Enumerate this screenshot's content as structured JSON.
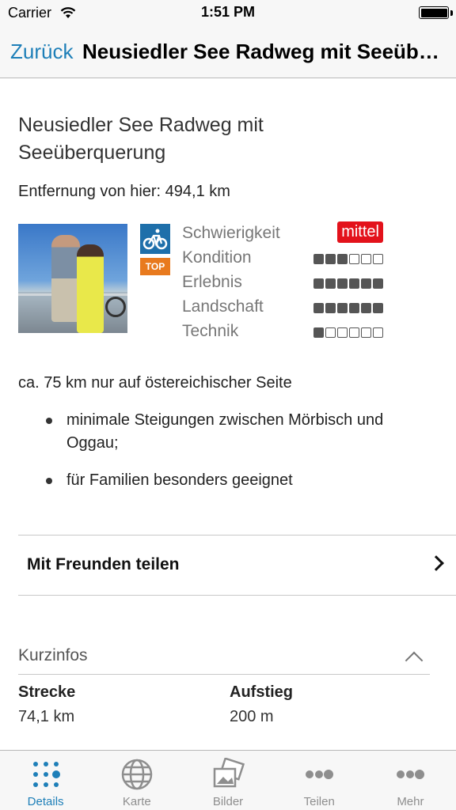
{
  "status_bar": {
    "carrier": "Carrier",
    "time": "1:51 PM"
  },
  "nav": {
    "back_label": "Zurück",
    "title": "Neusiedler See Radweg mit Seeüberquerung"
  },
  "route": {
    "title": "Neusiedler See Radweg mit Seeüberquerung",
    "distance": "Entfernung von hier: 494,1 km",
    "badge": "TOP",
    "ratings": [
      {
        "label": "Schwierigkeit",
        "value": "mittel"
      },
      {
        "label": "Kondition",
        "filled": 3,
        "total": 6
      },
      {
        "label": "Erlebnis",
        "filled": 6,
        "total": 6
      },
      {
        "label": "Landschaft",
        "filled": 6,
        "total": 6
      },
      {
        "label": "Technik",
        "filled": 1,
        "total": 6
      }
    ],
    "description": "ca. 75 km nur auf östereichischer Seite",
    "bullets": [
      "minimale Steigungen zwischen Mörbisch und Oggau;",
      "für Familien besonders geeignet"
    ]
  },
  "share": {
    "label": "Mit Freunden teilen"
  },
  "kurzinfos": {
    "header": "Kurzinfos",
    "items": [
      {
        "key": "Strecke",
        "value": "74,1 km"
      },
      {
        "key": "Aufstieg",
        "value": "200 m"
      }
    ]
  },
  "tabs": [
    {
      "label": "Details",
      "icon": "dots-grid-icon",
      "active": true
    },
    {
      "label": "Karte",
      "icon": "globe-icon",
      "active": false
    },
    {
      "label": "Bilder",
      "icon": "pictures-icon",
      "active": false
    },
    {
      "label": "Teilen",
      "icon": "share-dots-icon",
      "active": false
    },
    {
      "label": "Mehr",
      "icon": "more-dots-icon",
      "active": false
    }
  ],
  "colors": {
    "accent": "#1e7fb8",
    "difficulty": "#e3121b",
    "top_badge": "#e87a1e",
    "bike_badge": "#1e6faa"
  }
}
